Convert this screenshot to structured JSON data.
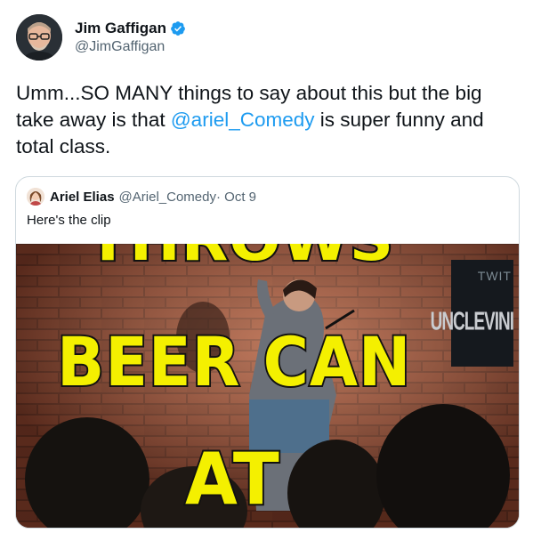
{
  "author": {
    "name": "Jim Gaffigan",
    "handle": "@JimGaffigan",
    "verified": true
  },
  "tweet": {
    "text_before": "Umm...SO MANY things to say about this but the big take away is that ",
    "mention": "@ariel_Comedy",
    "text_after": " is super funny and total class."
  },
  "quoted_tweet": {
    "name": "Ariel Elias",
    "handle": "@Ariel_Comedy",
    "date": "· Oct 9",
    "text": "Here's the clip"
  },
  "video_captions": {
    "line1": "THROWS",
    "line2": "BEER CAN",
    "line3": "AT"
  },
  "video_watermark": {
    "top": "TWIT",
    "bottom": "UNCLEVINI"
  },
  "colors": {
    "link": "#1d9bf0",
    "verified": "#1d9bf0",
    "caption": "#f4f000",
    "text": "#0f1419",
    "secondary": "#536471"
  }
}
